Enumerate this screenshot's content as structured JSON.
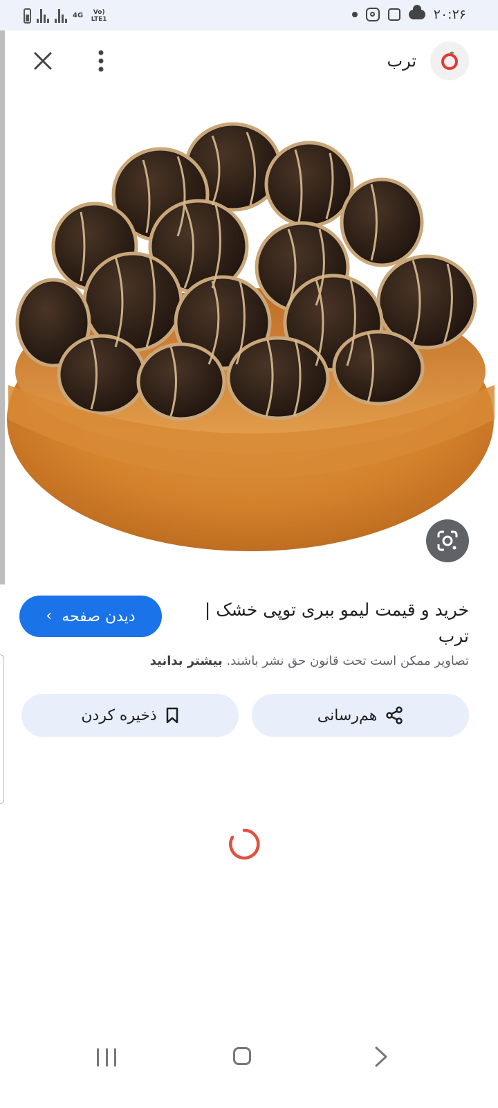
{
  "status_bar": {
    "network_label_top": "4G",
    "network_label_bottom": "Vo) LTE1",
    "time": "۲۰:۲۶"
  },
  "app_bar": {
    "site_name": "ترب",
    "close_icon": "close-icon",
    "menu_icon": "more-vert-icon"
  },
  "image": {
    "subject": "dried-lemons-in-wooden-bowl",
    "lens_icon": "google-lens-icon"
  },
  "result": {
    "title": "خرید و قیمت لیمو ببری توپی خشک | ترب",
    "visit_label": "دیدن صفحه",
    "copyright_text": "تصاویر ممکن است تحت قانون حق نشر باشند.",
    "learn_more": "بیشتر بدانید"
  },
  "actions": {
    "share_label": "هم‌رسانی",
    "save_label": "ذخیره کردن"
  },
  "colors": {
    "accent": "#1a73e8",
    "pill_bg": "#e8eefa",
    "spinner": "#e0513f"
  }
}
